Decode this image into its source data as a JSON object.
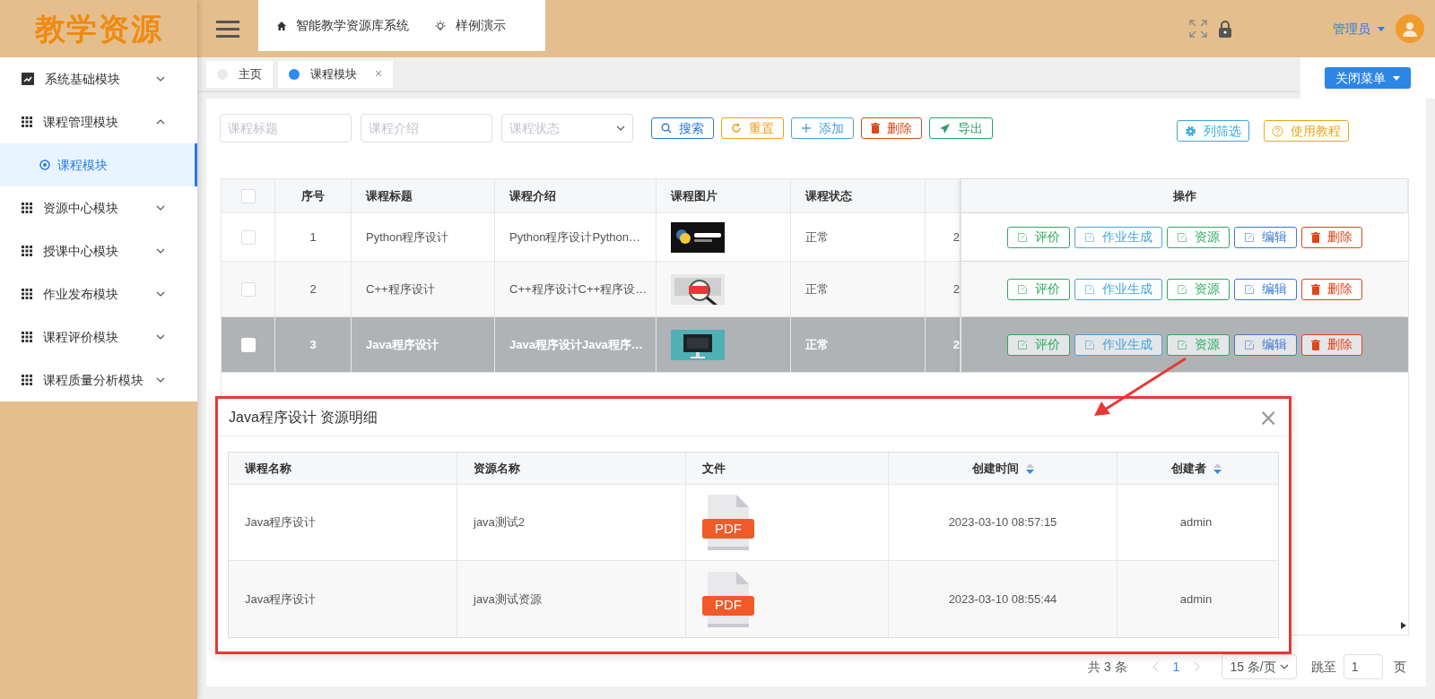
{
  "app": {
    "logo": "教学资源"
  },
  "header": {
    "breadcrumbs": [
      {
        "label": "智能教学资源库系统"
      },
      {
        "label": "样例演示"
      }
    ],
    "user": "管理员"
  },
  "sidebar": {
    "items": [
      {
        "label": "系统基础模块",
        "expanded": false
      },
      {
        "label": "课程管理模块",
        "expanded": true,
        "children": [
          {
            "label": "课程模块",
            "selected": true
          }
        ]
      },
      {
        "label": "资源中心模块",
        "expanded": false
      },
      {
        "label": "授课中心模块",
        "expanded": false
      },
      {
        "label": "作业发布模块",
        "expanded": false
      },
      {
        "label": "课程评价模块",
        "expanded": false
      },
      {
        "label": "课程质量分析模块",
        "expanded": false
      }
    ]
  },
  "tabs": [
    {
      "label": "主页",
      "selected": false
    },
    {
      "label": "课程模块",
      "selected": true,
      "close": "×"
    }
  ],
  "close_menu_button": "关闭菜单",
  "filters": [
    {
      "kind": "input",
      "placeholder": "课程标题"
    },
    {
      "kind": "input",
      "placeholder": "课程介绍"
    },
    {
      "kind": "select",
      "placeholder": "课程状态"
    }
  ],
  "toolbar": [
    {
      "label": "搜索",
      "color": "#2d78d3"
    },
    {
      "label": "重置",
      "color": "#f0a020"
    },
    {
      "label": "添加",
      "color": "#4aa3df"
    },
    {
      "label": "删除",
      "color": "#d9481c"
    },
    {
      "label": "导出",
      "color": "#2aa068"
    }
  ],
  "right_buttons": [
    {
      "label": "列筛选",
      "color": "#38a8d8"
    },
    {
      "label": "使用教程",
      "color": "#e8a818"
    }
  ],
  "table": {
    "header_checked": false,
    "columns": [
      "序号",
      "课程标题",
      "课程介绍",
      "课程图片",
      "课程状态",
      "操作"
    ],
    "rows": [
      {
        "checked": false,
        "selected": false,
        "index": "1",
        "title": "Python程序设计",
        "intro": "Python程序设计Python…",
        "image": {
          "kind": "picture"
        },
        "status": "正常",
        "column_7": "2",
        "actions": [
          {
            "label": "评价",
            "color": "#2eaa5c"
          },
          {
            "label": "作业生成",
            "color": "#44a6dc"
          },
          {
            "label": "资源",
            "color": "#2eaa5c"
          },
          {
            "label": "编辑",
            "color": "#3a7bd5"
          },
          {
            "label": "删除",
            "color": "#e0451b"
          }
        ]
      },
      {
        "checked": false,
        "selected": false,
        "index": "2",
        "title": "C++程序设计",
        "intro": "C++程序设计C++程序设…",
        "image": {
          "kind": "picture"
        },
        "status": "正常",
        "column_7": "2",
        "actions": [
          {
            "label": "评价",
            "color": "#2eaa5c"
          },
          {
            "label": "作业生成",
            "color": "#44a6dc"
          },
          {
            "label": "资源",
            "color": "#2eaa5c"
          },
          {
            "label": "编辑",
            "color": "#3a7bd5"
          },
          {
            "label": "删除",
            "color": "#e0451b"
          }
        ]
      },
      {
        "checked": false,
        "selected": true,
        "index": "3",
        "title": "Java程序设计",
        "intro": "Java程序设计Java程序…",
        "image": {
          "kind": "picture"
        },
        "status": "正常",
        "column_7": "2",
        "actions": [
          {
            "label": "评价",
            "color": "#2eaa5c"
          },
          {
            "label": "作业生成",
            "color": "#44a6dc"
          },
          {
            "label": "资源",
            "color": "#2eaa5c"
          },
          {
            "label": "编辑",
            "color": "#3a7bd5"
          },
          {
            "label": "删除",
            "color": "#e0451b"
          }
        ]
      }
    ]
  },
  "dialog": {
    "title": "Java程序设计 资源明细",
    "close": "×",
    "columns": [
      {
        "label": "课程名称",
        "sortable": false
      },
      {
        "label": "资源名称",
        "sortable": false
      },
      {
        "label": "文件",
        "sortable": false
      },
      {
        "label": "创建时间",
        "sortable": true
      },
      {
        "label": "创建者",
        "sortable": true
      }
    ],
    "rows": [
      {
        "course": "Java程序设计",
        "resource": "java测试2",
        "file": "PDF",
        "created": "2023-03-10 08:57:15",
        "creator": "admin"
      },
      {
        "course": "Java程序设计",
        "resource": "java测试资源",
        "file": "PDF",
        "created": "2023-03-10 08:55:44",
        "creator": "admin"
      }
    ]
  },
  "pagination": {
    "total": "共 3 条",
    "page": "1",
    "page_size": "15 条/页",
    "jump_label": "跳至",
    "jump_value": "1",
    "page_unit": "页"
  }
}
